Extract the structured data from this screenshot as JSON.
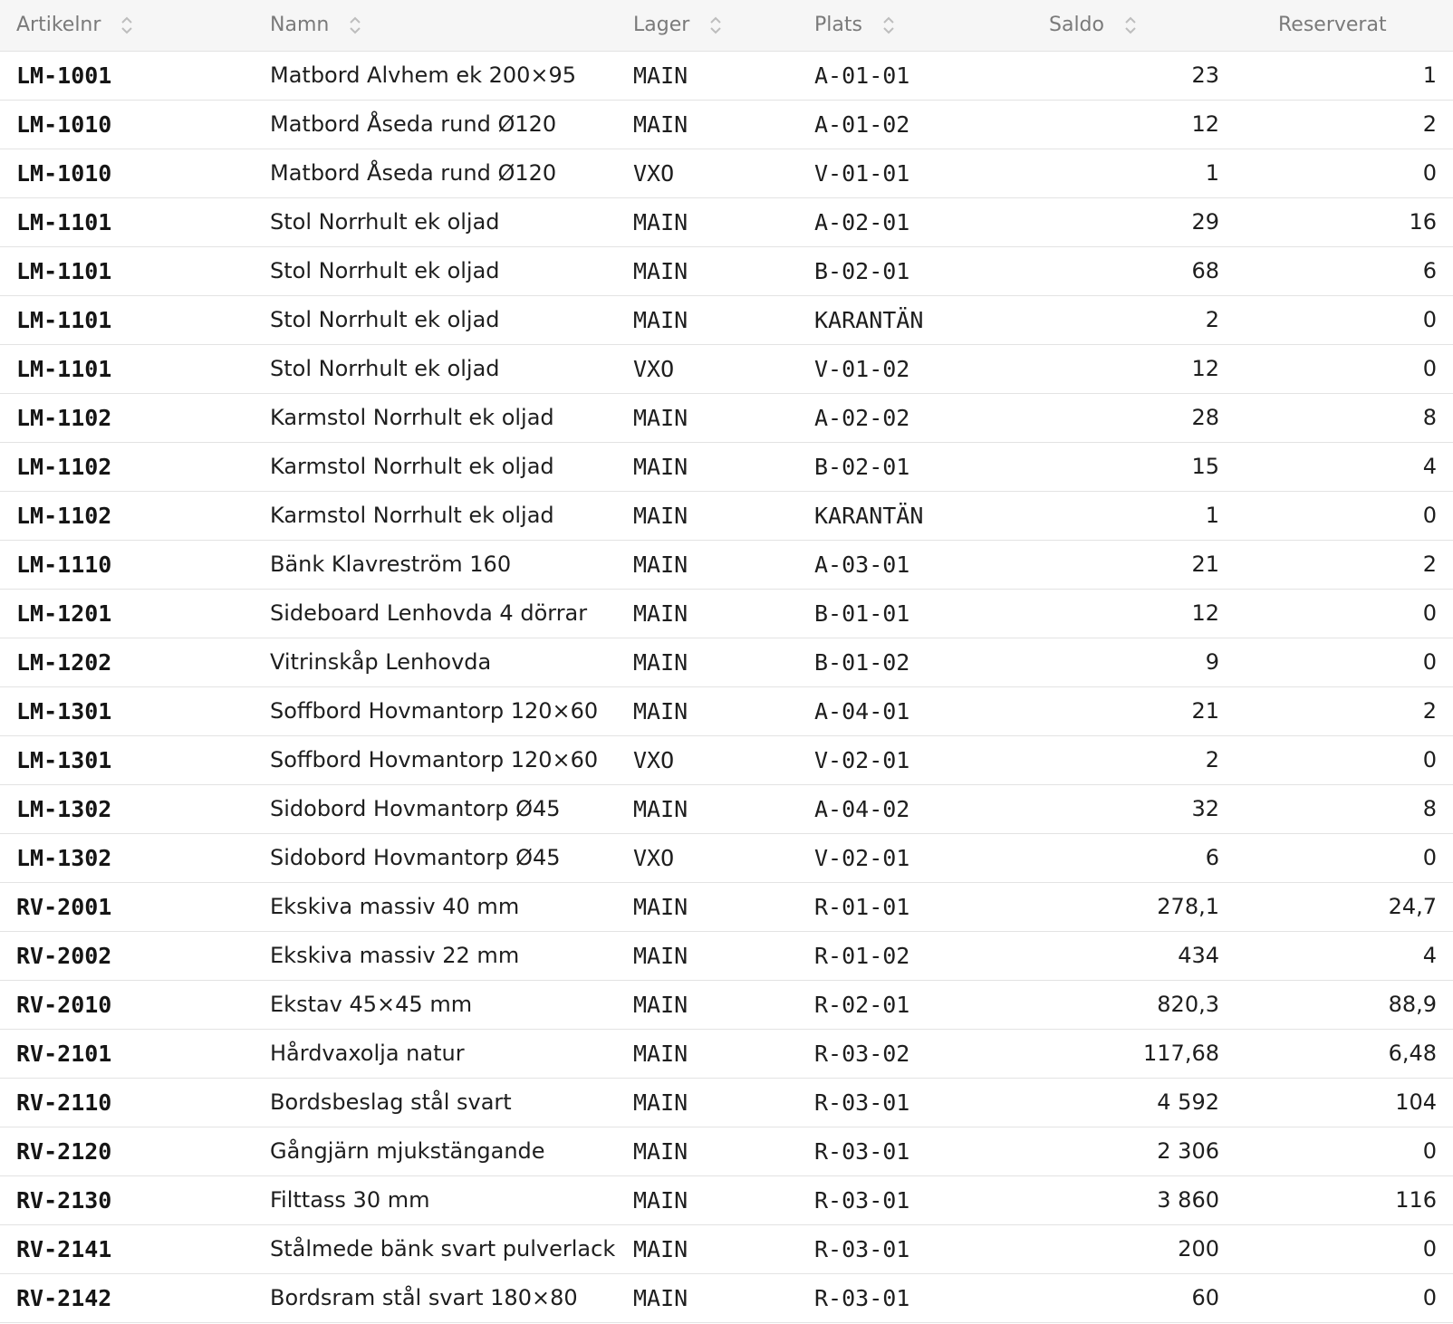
{
  "table": {
    "columns": [
      {
        "key": "artikelnr",
        "label": "Artikelnr",
        "sortable": true
      },
      {
        "key": "namn",
        "label": "Namn",
        "sortable": true
      },
      {
        "key": "lager",
        "label": "Lager",
        "sortable": true
      },
      {
        "key": "plats",
        "label": "Plats",
        "sortable": true
      },
      {
        "key": "saldo",
        "label": "Saldo",
        "sortable": true
      },
      {
        "key": "reserverat",
        "label": "Reserverat",
        "sortable": false
      }
    ],
    "rows": [
      {
        "artikelnr": "LM-1001",
        "namn": "Matbord Alvhem ek 200×95",
        "lager": "MAIN",
        "plats": "A-01-01",
        "saldo": "23",
        "reserverat": "1"
      },
      {
        "artikelnr": "LM-1010",
        "namn": "Matbord Åseda rund Ø120",
        "lager": "MAIN",
        "plats": "A-01-02",
        "saldo": "12",
        "reserverat": "2"
      },
      {
        "artikelnr": "LM-1010",
        "namn": "Matbord Åseda rund Ø120",
        "lager": "VXO",
        "plats": "V-01-01",
        "saldo": "1",
        "reserverat": "0"
      },
      {
        "artikelnr": "LM-1101",
        "namn": "Stol Norrhult ek oljad",
        "lager": "MAIN",
        "plats": "A-02-01",
        "saldo": "29",
        "reserverat": "16"
      },
      {
        "artikelnr": "LM-1101",
        "namn": "Stol Norrhult ek oljad",
        "lager": "MAIN",
        "plats": "B-02-01",
        "saldo": "68",
        "reserverat": "6"
      },
      {
        "artikelnr": "LM-1101",
        "namn": "Stol Norrhult ek oljad",
        "lager": "MAIN",
        "plats": "KARANTÄN",
        "saldo": "2",
        "reserverat": "0"
      },
      {
        "artikelnr": "LM-1101",
        "namn": "Stol Norrhult ek oljad",
        "lager": "VXO",
        "plats": "V-01-02",
        "saldo": "12",
        "reserverat": "0"
      },
      {
        "artikelnr": "LM-1102",
        "namn": "Karmstol Norrhult ek oljad",
        "lager": "MAIN",
        "plats": "A-02-02",
        "saldo": "28",
        "reserverat": "8"
      },
      {
        "artikelnr": "LM-1102",
        "namn": "Karmstol Norrhult ek oljad",
        "lager": "MAIN",
        "plats": "B-02-01",
        "saldo": "15",
        "reserverat": "4"
      },
      {
        "artikelnr": "LM-1102",
        "namn": "Karmstol Norrhult ek oljad",
        "lager": "MAIN",
        "plats": "KARANTÄN",
        "saldo": "1",
        "reserverat": "0"
      },
      {
        "artikelnr": "LM-1110",
        "namn": "Bänk Klavreström 160",
        "lager": "MAIN",
        "plats": "A-03-01",
        "saldo": "21",
        "reserverat": "2"
      },
      {
        "artikelnr": "LM-1201",
        "namn": "Sideboard Lenhovda 4 dörrar",
        "lager": "MAIN",
        "plats": "B-01-01",
        "saldo": "12",
        "reserverat": "0"
      },
      {
        "artikelnr": "LM-1202",
        "namn": "Vitrinskåp Lenhovda",
        "lager": "MAIN",
        "plats": "B-01-02",
        "saldo": "9",
        "reserverat": "0"
      },
      {
        "artikelnr": "LM-1301",
        "namn": "Soffbord Hovmantorp 120×60",
        "lager": "MAIN",
        "plats": "A-04-01",
        "saldo": "21",
        "reserverat": "2"
      },
      {
        "artikelnr": "LM-1301",
        "namn": "Soffbord Hovmantorp 120×60",
        "lager": "VXO",
        "plats": "V-02-01",
        "saldo": "2",
        "reserverat": "0"
      },
      {
        "artikelnr": "LM-1302",
        "namn": "Sidobord Hovmantorp Ø45",
        "lager": "MAIN",
        "plats": "A-04-02",
        "saldo": "32",
        "reserverat": "8"
      },
      {
        "artikelnr": "LM-1302",
        "namn": "Sidobord Hovmantorp Ø45",
        "lager": "VXO",
        "plats": "V-02-01",
        "saldo": "6",
        "reserverat": "0"
      },
      {
        "artikelnr": "RV-2001",
        "namn": "Ekskiva massiv 40 mm",
        "lager": "MAIN",
        "plats": "R-01-01",
        "saldo": "278,1",
        "reserverat": "24,7"
      },
      {
        "artikelnr": "RV-2002",
        "namn": "Ekskiva massiv 22 mm",
        "lager": "MAIN",
        "plats": "R-01-02",
        "saldo": "434",
        "reserverat": "4"
      },
      {
        "artikelnr": "RV-2010",
        "namn": "Ekstav 45×45 mm",
        "lager": "MAIN",
        "plats": "R-02-01",
        "saldo": "820,3",
        "reserverat": "88,9"
      },
      {
        "artikelnr": "RV-2101",
        "namn": "Hårdvaxolja natur",
        "lager": "MAIN",
        "plats": "R-03-02",
        "saldo": "117,68",
        "reserverat": "6,48"
      },
      {
        "artikelnr": "RV-2110",
        "namn": "Bordsbeslag stål svart",
        "lager": "MAIN",
        "plats": "R-03-01",
        "saldo": "4 592",
        "reserverat": "104"
      },
      {
        "artikelnr": "RV-2120",
        "namn": "Gångjärn mjukstängande",
        "lager": "MAIN",
        "plats": "R-03-01",
        "saldo": "2 306",
        "reserverat": "0"
      },
      {
        "artikelnr": "RV-2130",
        "namn": "Filttass 30 mm",
        "lager": "MAIN",
        "plats": "R-03-01",
        "saldo": "3 860",
        "reserverat": "116"
      },
      {
        "artikelnr": "RV-2141",
        "namn": "Stålmede bänk svart pulverlack",
        "lager": "MAIN",
        "plats": "R-03-01",
        "saldo": "200",
        "reserverat": "0"
      },
      {
        "artikelnr": "RV-2142",
        "namn": "Bordsram stål svart 180×80",
        "lager": "MAIN",
        "plats": "R-03-01",
        "saldo": "60",
        "reserverat": "0"
      }
    ]
  },
  "icons": {
    "sort": "sort-updown-icon"
  },
  "colors": {
    "header_bg": "#f6f6f6",
    "header_text": "#7a7a7a",
    "row_border": "#e3e3e3",
    "body_text": "#1c1c1c",
    "sort_icon": "#bdbdbd"
  }
}
